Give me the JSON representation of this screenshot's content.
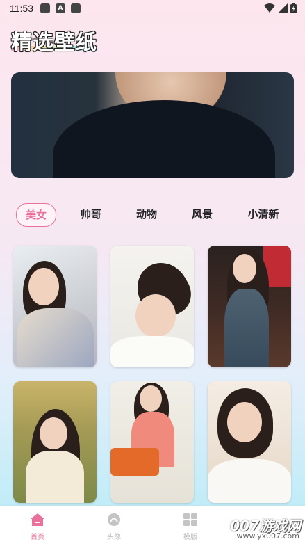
{
  "status_bar": {
    "time": "11:53",
    "notif_icon_a": "A"
  },
  "header": {
    "title": "精选壁纸"
  },
  "tabs": [
    {
      "label": "美女",
      "active": true
    },
    {
      "label": "帅哥",
      "active": false
    },
    {
      "label": "动物",
      "active": false
    },
    {
      "label": "风景",
      "active": false
    },
    {
      "label": "小清新",
      "active": false
    }
  ],
  "bottom_nav": [
    {
      "label": "首页",
      "icon": "home-icon",
      "active": true
    },
    {
      "label": "头像",
      "icon": "avatar-icon",
      "active": false
    },
    {
      "label": "模版",
      "icon": "template-icon",
      "active": false
    }
  ],
  "watermark": {
    "brand": "007游戏网",
    "url": "www.yx007.com"
  },
  "colors": {
    "accent": "#e8729c",
    "nav_inactive": "#bbbbbb"
  }
}
